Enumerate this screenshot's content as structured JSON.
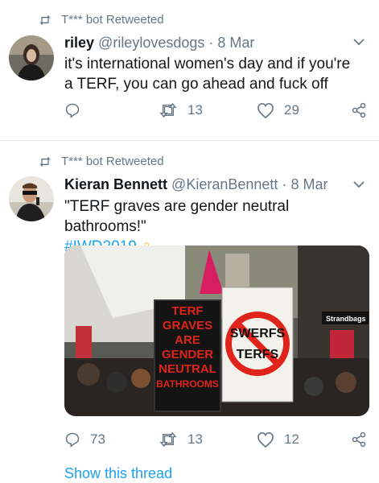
{
  "tweets": [
    {
      "retweeted_by": "T*** bot Retweeted",
      "name": "riley",
      "handle": "@rileylovesdogs",
      "separator": "·",
      "date": "8 Mar",
      "text": "it's international women's day and if you're a TERF, you can go ahead and fuck off",
      "replies": "",
      "retweets": "13",
      "likes": "29"
    },
    {
      "retweeted_by": "T*** bot Retweeted",
      "name": "Kieran Bennett",
      "handle": "@KieranBennett",
      "separator": "·",
      "date": "8 Mar",
      "text": "\"TERF graves are gender neutral bathrooms!\"",
      "hashtag": "#IWD2019",
      "emoji": "♀",
      "replies": "73",
      "retweets": "13",
      "likes": "12",
      "media": {
        "sign_left": [
          "TERF",
          "GRAVES",
          "ARE",
          "GENDER",
          "NEUTRAL",
          "BATHROOMS"
        ],
        "sign_right": [
          "SWERFS",
          "TERFS"
        ],
        "store_sign": "Strandbags"
      },
      "show_thread": "Show this thread"
    }
  ],
  "colors": {
    "accent": "#1da1f2",
    "muted": "#657786",
    "emoji": "#f7b500",
    "sign_red": "#e0241c"
  }
}
